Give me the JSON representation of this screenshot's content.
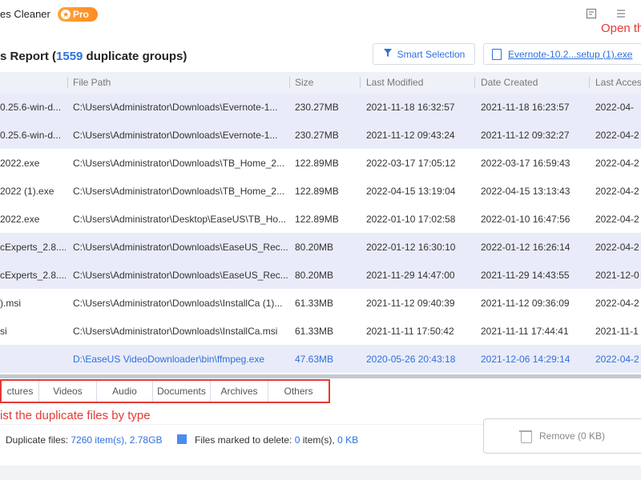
{
  "app": {
    "title": "es Cleaner",
    "badge": "Pro"
  },
  "annotations": {
    "open": "Open th",
    "by_type": "ist the duplicate files by type"
  },
  "report": {
    "title_prefix": "s Report (",
    "group_count": "1559",
    "title_suffix": " duplicate groups)"
  },
  "toolbar": {
    "smart_selection": "Smart Selection",
    "file_chip": "Evernote-10.2...setup (1).exe"
  },
  "table": {
    "headers": [
      "File Path",
      "Size",
      "Last Modified",
      "Date Created",
      "Last Acces"
    ],
    "rows": [
      {
        "name": "0.25.6-win-d...",
        "path": "C:\\Users\\Administrator\\Downloads\\Evernote-1...",
        "size": "230.27MB",
        "modified": "2021-11-18 16:32:57",
        "created": "2021-11-18 16:23:57",
        "accessed": "2022-04-"
      },
      {
        "name": "0.25.6-win-d...",
        "path": "C:\\Users\\Administrator\\Downloads\\Evernote-1...",
        "size": "230.27MB",
        "modified": "2021-11-12 09:43:24",
        "created": "2021-11-12 09:32:27",
        "accessed": "2022-04-2"
      },
      {
        "name": "2022.exe",
        "path": "C:\\Users\\Administrator\\Downloads\\TB_Home_2...",
        "size": "122.89MB",
        "modified": "2022-03-17 17:05:12",
        "created": "2022-03-17 16:59:43",
        "accessed": "2022-04-2"
      },
      {
        "name": "2022 (1).exe",
        "path": "C:\\Users\\Administrator\\Downloads\\TB_Home_2...",
        "size": "122.89MB",
        "modified": "2022-04-15 13:19:04",
        "created": "2022-04-15 13:13:43",
        "accessed": "2022-04-2"
      },
      {
        "name": "2022.exe",
        "path": "C:\\Users\\Administrator\\Desktop\\EaseUS\\TB_Ho...",
        "size": "122.89MB",
        "modified": "2022-01-10 17:02:58",
        "created": "2022-01-10 16:47:56",
        "accessed": "2022-04-2"
      },
      {
        "name": "cExperts_2.8....",
        "path": "C:\\Users\\Administrator\\Downloads\\EaseUS_Rec...",
        "size": "80.20MB",
        "modified": "2022-01-12 16:30:10",
        "created": "2022-01-12 16:26:14",
        "accessed": "2022-04-2"
      },
      {
        "name": "cExperts_2.8....",
        "path": "C:\\Users\\Administrator\\Downloads\\EaseUS_Rec...",
        "size": "80.20MB",
        "modified": "2021-11-29 14:47:00",
        "created": "2021-11-29 14:43:55",
        "accessed": "2021-12-0"
      },
      {
        "name": ").msi",
        "path": "C:\\Users\\Administrator\\Downloads\\InstallCa (1)...",
        "size": "61.33MB",
        "modified": "2021-11-12 09:40:39",
        "created": "2021-11-12 09:36:09",
        "accessed": "2022-04-2"
      },
      {
        "name": "si",
        "path": "C:\\Users\\Administrator\\Downloads\\InstallCa.msi",
        "size": "61.33MB",
        "modified": "2021-11-11 17:50:42",
        "created": "2021-11-11 17:44:41",
        "accessed": "2021-11-1"
      },
      {
        "name": "",
        "path": "D:\\EaseUS VideoDownloader\\bin\\ffmpeg.exe",
        "size": "47.63MB",
        "modified": "2020-05-26 20:43:18",
        "created": "2021-12-06 14:29:14",
        "accessed": "2022-04-2"
      }
    ]
  },
  "tabs": [
    "ctures",
    "Videos",
    "Audio",
    "Documents",
    "Archives",
    "Others"
  ],
  "footer": {
    "dup_label": "Duplicate files: ",
    "dup_items": "7260",
    "dup_items_suffix": " item(s), ",
    "dup_size": "2.78GB",
    "del_label": "Files marked to delete: ",
    "del_items": "0",
    "del_items_suffix": " item(s), ",
    "del_size": "0 KB",
    "remove_label": "Remove (0 KB)"
  },
  "colors": {
    "accent": "#2f6fde",
    "annotation": "#e53935",
    "badge": "#ff8a1f"
  }
}
